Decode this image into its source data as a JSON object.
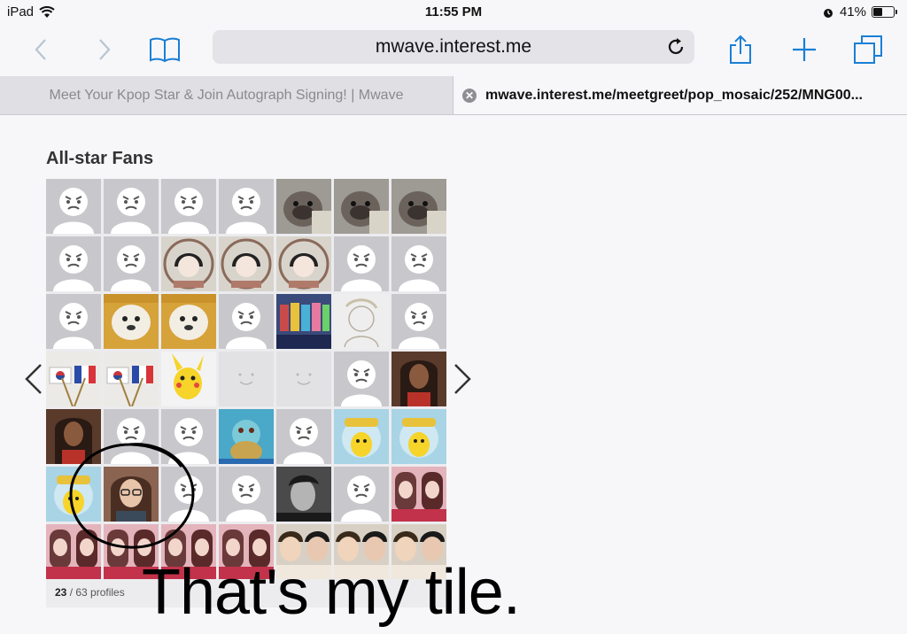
{
  "status_bar": {
    "device": "iPad",
    "time": "11:55 PM",
    "battery": "41%",
    "battery_level": 0.41,
    "icons": [
      "wifi-icon",
      "alarm-icon",
      "battery-icon"
    ]
  },
  "toolbar": {
    "address": "mwave.interest.me",
    "icons": [
      "back-icon",
      "forward-icon",
      "bookmarks-icon",
      "reload-icon",
      "share-icon",
      "new-tab-icon",
      "tabs-icon"
    ]
  },
  "tabs": [
    {
      "label": "Meet Your Kpop Star & Join Autograph Signing! | Mwave",
      "active": false
    },
    {
      "label": "mwave.interest.me/meetgreet/pop_mosaic/252/MNG00...",
      "active": true
    }
  ],
  "section": {
    "title": "All-star Fans",
    "count_current": "23",
    "count_total": " / 63 profiles"
  },
  "caption": "That's my tile.",
  "tiles": [
    "avatar",
    "avatar",
    "avatar",
    "avatar",
    "dog",
    "dog",
    "dog",
    "avatar",
    "avatar",
    "girl",
    "girl",
    "girl",
    "avatar",
    "avatar",
    "avatar",
    "puppy",
    "puppy",
    "avatar",
    "group",
    "sketch",
    "avatar",
    "flags",
    "flags",
    "pikachu",
    "face",
    "face",
    "avatar",
    "portrait",
    "portrait",
    "avatar",
    "avatar",
    "squirtle",
    "avatar",
    "pikachu-badge",
    "pikachu-badge",
    "pikachu-badge",
    "selfie",
    "avatar",
    "avatar",
    "bw-man",
    "avatar",
    "idol-pink",
    "idol-pink",
    "idol-pink",
    "idol-pink",
    "idol-pink",
    "duo",
    "duo",
    "duo"
  ],
  "colors": {
    "avatar_bg": "#c8c8cc",
    "ink": "#000000",
    "link_blue": "#1a7fd6"
  }
}
